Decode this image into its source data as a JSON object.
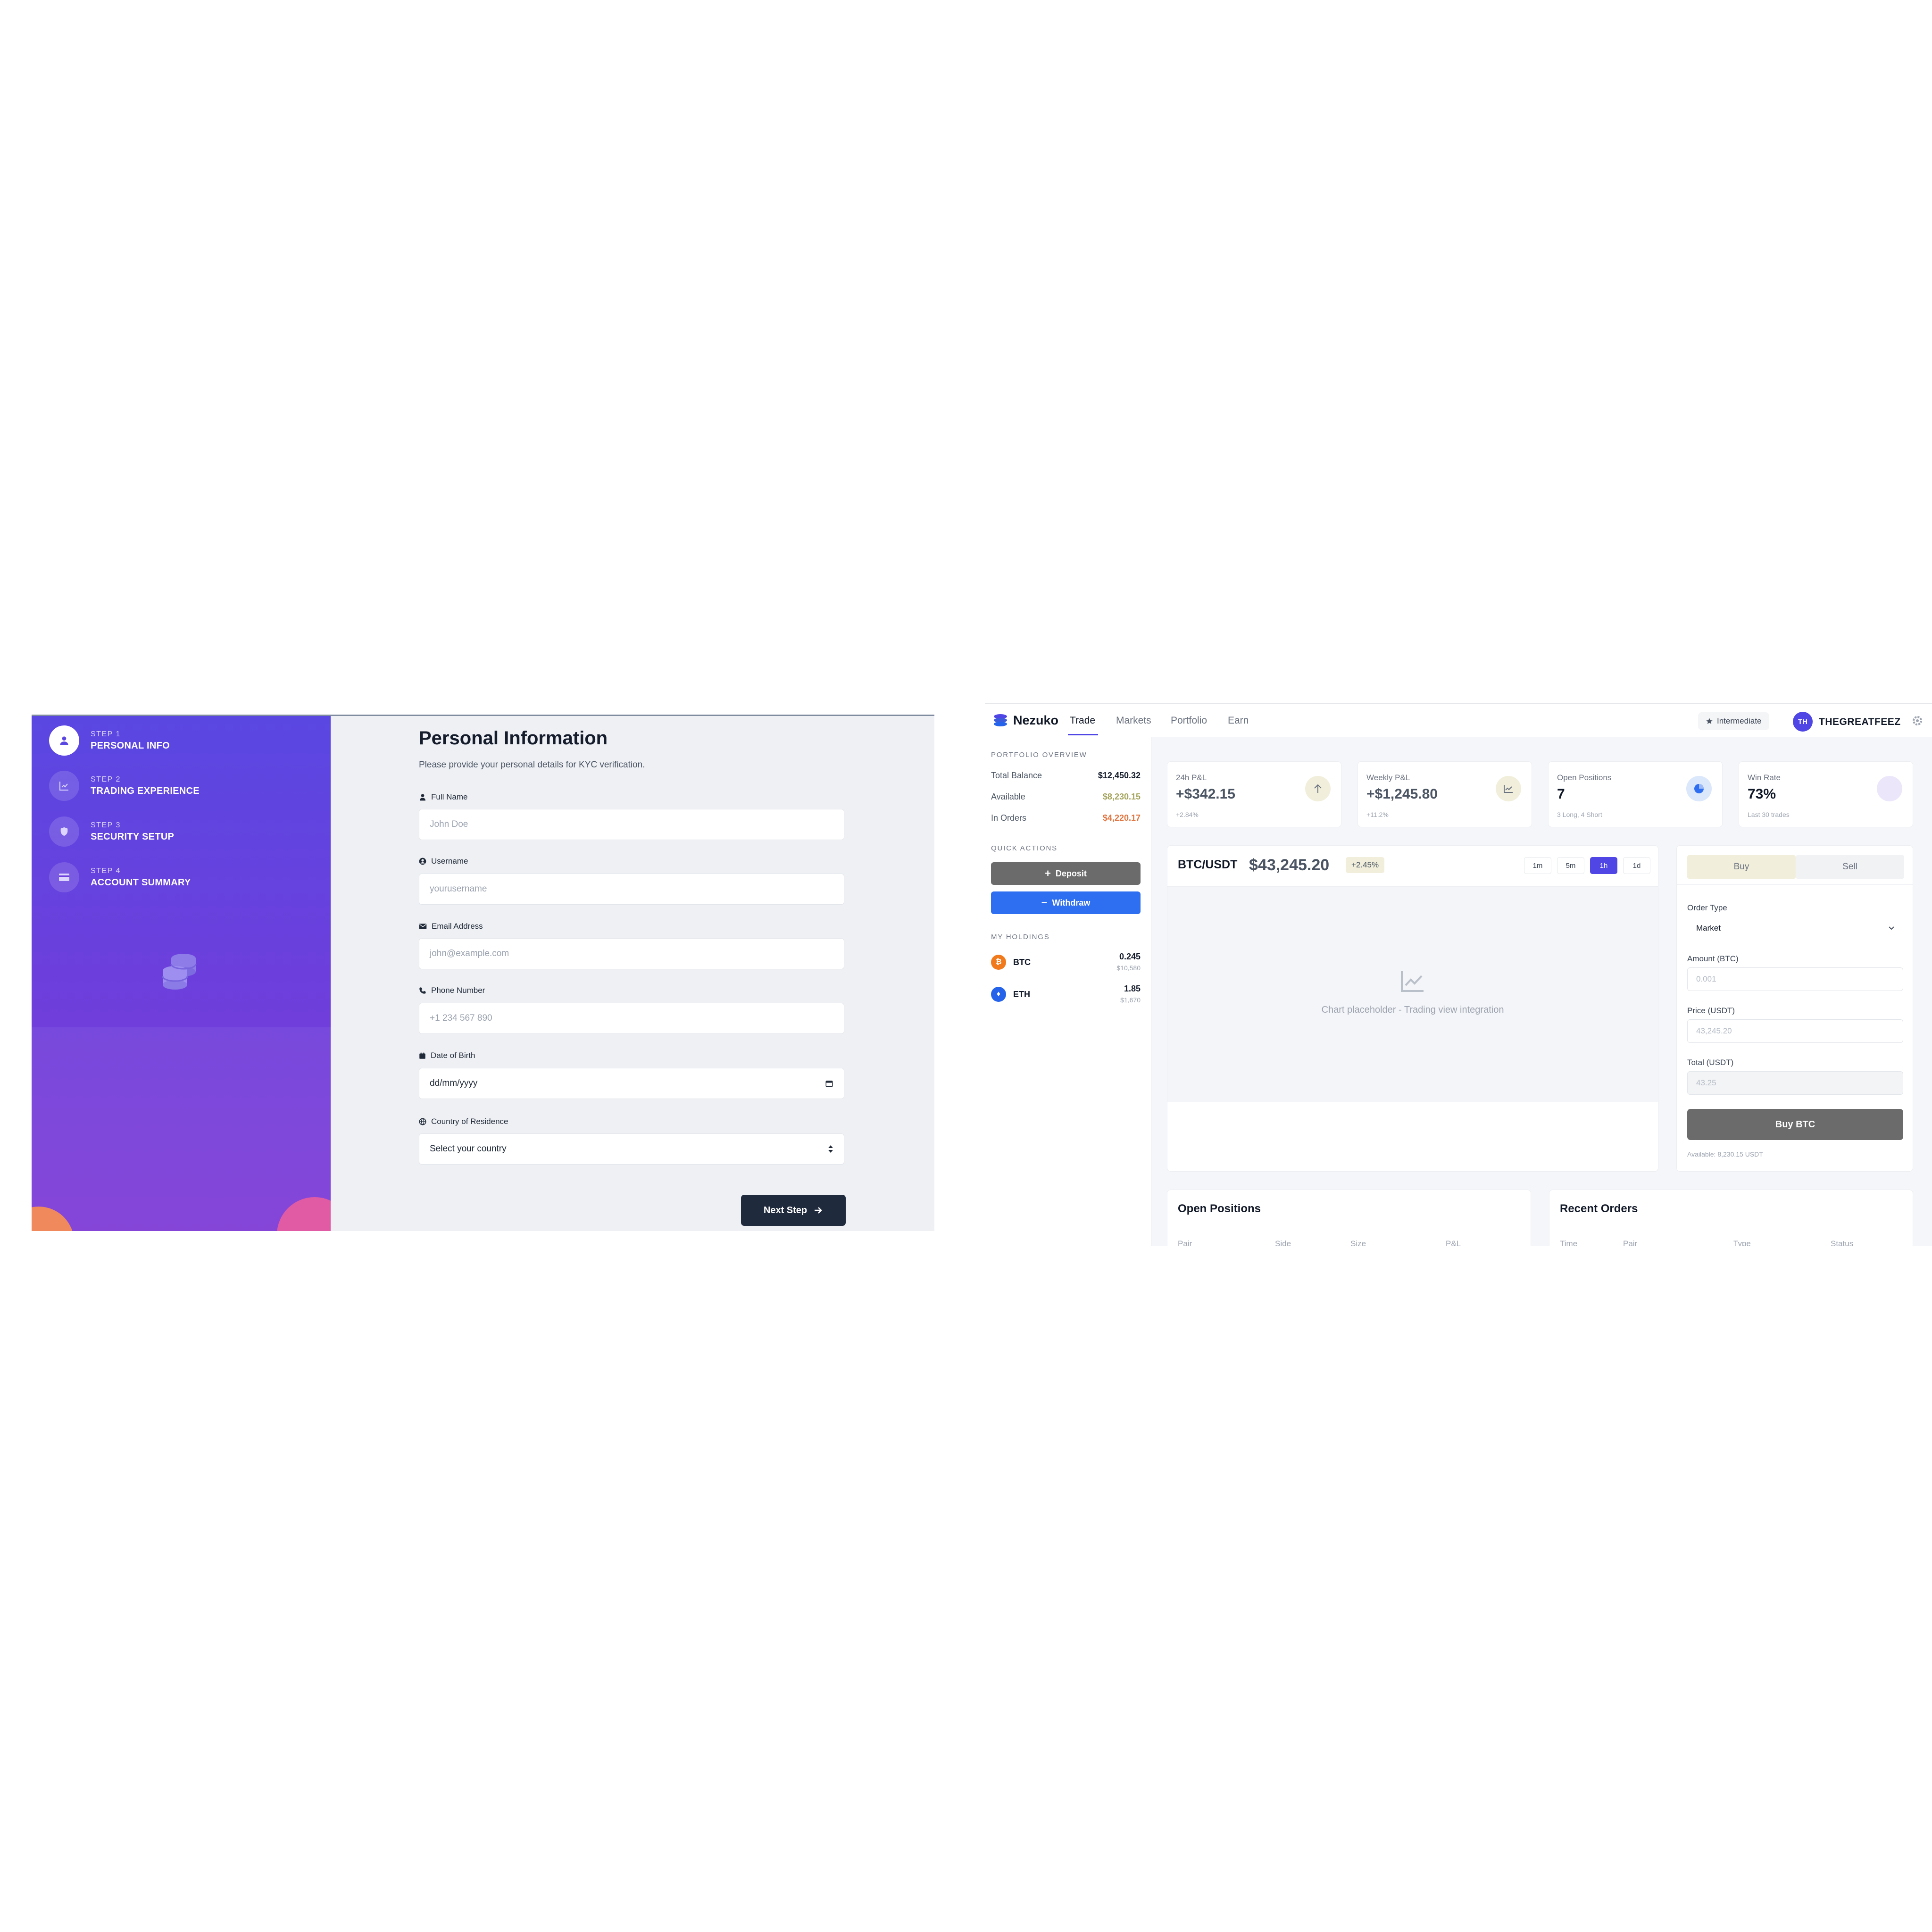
{
  "kyc": {
    "steps": [
      {
        "step": "STEP 1",
        "label": "PERSONAL INFO"
      },
      {
        "step": "STEP 2",
        "label": "TRADING EXPERIENCE"
      },
      {
        "step": "STEP 3",
        "label": "SECURITY SETUP"
      },
      {
        "step": "STEP 4",
        "label": "ACCOUNT SUMMARY"
      }
    ],
    "active_step": 1,
    "title": "Personal Information",
    "subtitle": "Please provide your personal details for KYC verification.",
    "fields": {
      "full_name": {
        "label": "Full Name",
        "placeholder": "John Doe"
      },
      "username": {
        "label": "Username",
        "placeholder": "yourusername"
      },
      "email": {
        "label": "Email Address",
        "placeholder": "john@example.com"
      },
      "phone": {
        "label": "Phone Number",
        "placeholder": "+1 234 567 890"
      },
      "dob": {
        "label": "Date of Birth",
        "value": "dd/mm/yyyy"
      },
      "country": {
        "label": "Country of Residence",
        "value": "Select your country"
      }
    },
    "next_label": "Next Step"
  },
  "trade": {
    "brand": "Nezuko",
    "nav": [
      "Trade",
      "Markets",
      "Portfolio",
      "Earn"
    ],
    "active_nav": "Trade",
    "level_badge": "Intermediate",
    "user": {
      "initials": "TH",
      "name": "THEGREATFEEZ"
    },
    "portfolio": {
      "heading": "PORTFOLIO OVERVIEW",
      "rows": [
        {
          "label": "Total Balance",
          "value": "$12,450.32",
          "color": "#111827"
        },
        {
          "label": "Available",
          "value": "$8,230.15",
          "color": "#a3a35c"
        },
        {
          "label": "In Orders",
          "value": "$4,220.17",
          "color": "#e0733e"
        }
      ]
    },
    "quick_actions": {
      "heading": "QUICK ACTIONS",
      "deposit": "Deposit",
      "withdraw": "Withdraw"
    },
    "holdings": {
      "heading": "MY HOLDINGS",
      "items": [
        {
          "symbol": "BTC",
          "amount": "0.245",
          "usd": "$10,580",
          "color": "#f07a1c"
        },
        {
          "symbol": "ETH",
          "amount": "1.85",
          "usd": "$1,670",
          "color": "#2563eb"
        }
      ]
    },
    "stats": [
      {
        "label": "24h P&L",
        "value": "+$342.15",
        "sub": "+2.84%",
        "icon": "arrow-up-icon",
        "icon_bg": "#f1efdb"
      },
      {
        "label": "Weekly P&L",
        "value": "+$1,245.80",
        "sub": "+11.2%",
        "icon": "line-chart-icon",
        "icon_bg": "#f1efdb"
      },
      {
        "label": "Open Positions",
        "value": "7",
        "sub": "3 Long, 4 Short",
        "icon": "pie-chart-icon",
        "icon_bg": "#dbe7fb"
      },
      {
        "label": "Win Rate",
        "value": "73%",
        "sub": "Last 30 trades",
        "icon": "trophy-icon",
        "icon_bg": "#ece6fb"
      }
    ],
    "chart": {
      "pair": "BTC/USDT",
      "price": "$43,245.20",
      "change": "+2.45%",
      "timeframes": [
        "1m",
        "5m",
        "1h",
        "1d"
      ],
      "active_timeframe": "1h",
      "placeholder": "Chart placeholder - Trading view integration"
    },
    "order": {
      "buy_tab": "Buy",
      "sell_tab": "Sell",
      "order_type_label": "Order Type",
      "order_type_value": "Market",
      "amount_label": "Amount (BTC)",
      "amount_placeholder": "0.001",
      "price_label": "Price (USDT)",
      "price_placeholder": "43,245.20",
      "total_label": "Total (USDT)",
      "total_value": "43.25",
      "submit": "Buy BTC",
      "available": "Available: 8,230.15 USDT"
    },
    "open_positions": {
      "title": "Open Positions",
      "columns": [
        "Pair",
        "Side",
        "Size",
        "P&L"
      ]
    },
    "recent_orders": {
      "title": "Recent Orders",
      "columns": [
        "Time",
        "Pair",
        "Type",
        "Status"
      ]
    }
  }
}
